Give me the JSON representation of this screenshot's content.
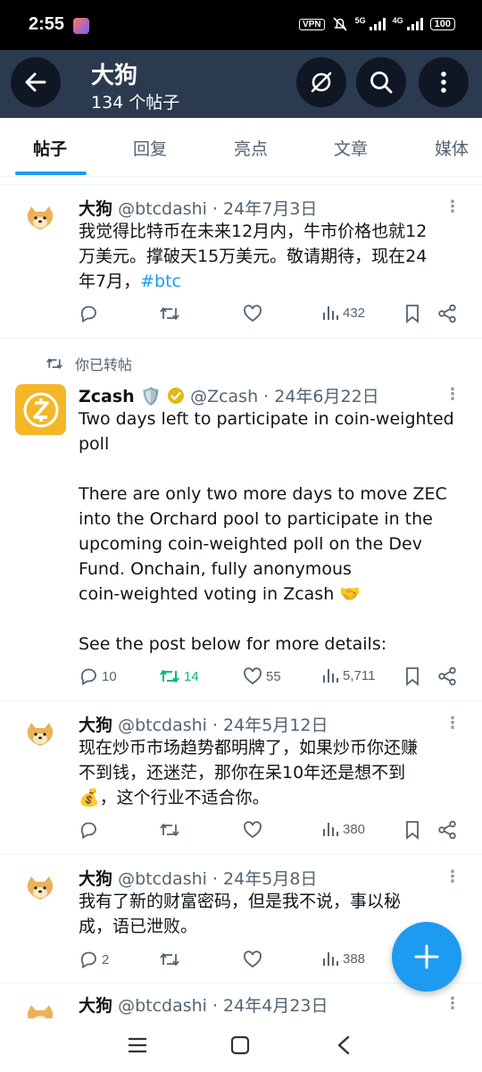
{
  "status_bar": {
    "time": "2:55",
    "vpn": "VPN",
    "net1": "5G",
    "net2": "4G",
    "battery": "100"
  },
  "header": {
    "title": "大狗",
    "subtitle": "134 个帖子"
  },
  "tabs": [
    {
      "label": "帖子",
      "active": true
    },
    {
      "label": "回复",
      "active": false
    },
    {
      "label": "亮点",
      "active": false
    },
    {
      "label": "文章",
      "active": false
    },
    {
      "label": "媒体",
      "active": false
    }
  ],
  "posts": [
    {
      "name": "大狗",
      "meta": "@btcdashi · 24年7月3日",
      "lines": [
        "我觉得比特币在未来12月内，牛市价格也就12",
        "万美元。撑破天15万美元。敬请期待，现在24",
        "年7月，"
      ],
      "hashtag": "#btc",
      "replies": "",
      "reposts": "",
      "likes": "",
      "views": "432"
    },
    {
      "retweet_note": "你已转帖",
      "name": "Zcash 🛡️",
      "meta": "@Zcash · 24年6月22日",
      "lines": [
        "Two days left to participate in coin-weighted",
        "poll",
        "",
        "There are only two more days to move ZEC",
        "into the Orchard pool to participate in the",
        "upcoming coin-weighted poll on the Dev",
        "Fund. Onchain, fully anonymous",
        "coin-weighted voting in Zcash 🤝",
        "",
        "See the post below for more details:"
      ],
      "replies": "10",
      "reposts": "14",
      "likes": "55",
      "views": "5,711"
    },
    {
      "name": "大狗",
      "meta": "@btcdashi · 24年5月12日",
      "lines": [
        "现在炒币市场趋势都明牌了，如果炒币你还赚",
        "不到钱，还迷茫，那你在呆10年还是想不到",
        "💰，这个行业不适合你。"
      ],
      "replies": "",
      "reposts": "",
      "likes": "",
      "views": "380"
    },
    {
      "name": "大狗",
      "meta": "@btcdashi · 24年5月8日",
      "lines": [
        "我有了新的财富密码，但是我不说，事以秘",
        "成，语已泄败。"
      ],
      "replies": "2",
      "reposts": "",
      "likes": "",
      "views": "388"
    },
    {
      "name": "大狗",
      "meta": "@btcdashi · 24年4月23日"
    }
  ],
  "more_glyph": "⋮",
  "colors": {
    "header_bg": "#2b3a4f",
    "accent": "#1d9bf0",
    "repost_green": "#00ba7c",
    "text": "#0f1419",
    "muted": "#536471"
  },
  "icons": [
    "back-arrow-icon",
    "grok-icon",
    "search-icon",
    "more-vertical-icon",
    "reply-icon",
    "repost-icon",
    "like-icon",
    "views-icon",
    "bookmark-icon",
    "share-icon",
    "compose-plus-icon"
  ]
}
